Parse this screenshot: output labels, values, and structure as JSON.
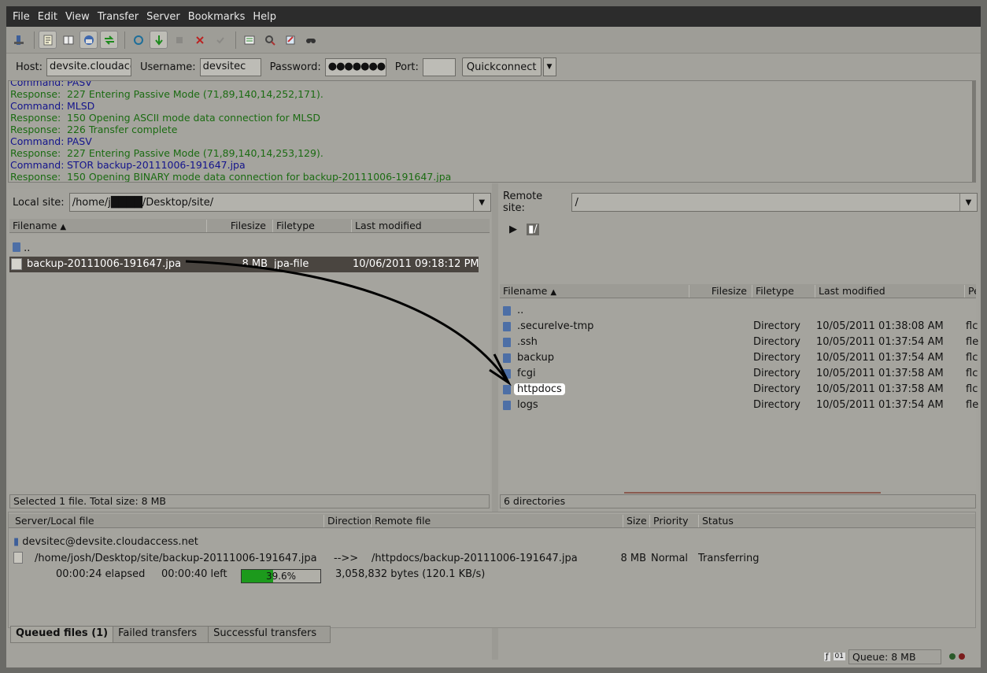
{
  "menu": [
    "File",
    "Edit",
    "View",
    "Transfer",
    "Server",
    "Bookmarks",
    "Help"
  ],
  "toolbar_icons": [
    "site-manager-icon",
    "toggle-log-icon",
    "toggle-local-tree-icon",
    "toggle-remote-tree-icon",
    "toggle-queue-icon",
    "refresh-icon",
    "process-queue-icon",
    "cancel-icon",
    "disconnect-icon",
    "reconnect-icon",
    "directory-listing-filters-icon",
    "sync-browse-icon",
    "compare-icon",
    "search-icon"
  ],
  "quickconnect": {
    "host_label": "Host:",
    "host": "devsite.cloudacc",
    "user_label": "Username:",
    "user": "devsitec",
    "pass_label": "Password:",
    "pass": "●●●●●●●",
    "port_label": "Port:",
    "port": "",
    "button": "Quickconnect"
  },
  "log": [
    {
      "k": "Command:",
      "t": "PASV",
      "type": "cmd"
    },
    {
      "k": "Response:",
      "t": "227 Entering Passive Mode (71,89,140,14,252,171).",
      "type": "resp"
    },
    {
      "k": "Command:",
      "t": "MLSD",
      "type": "cmd"
    },
    {
      "k": "Response:",
      "t": "150 Opening ASCII mode data connection for MLSD",
      "type": "resp"
    },
    {
      "k": "Response:",
      "t": "226 Transfer complete",
      "type": "resp"
    },
    {
      "k": "Command:",
      "t": "PASV",
      "type": "cmd"
    },
    {
      "k": "Response:",
      "t": "227 Entering Passive Mode (71,89,140,14,253,129).",
      "type": "resp"
    },
    {
      "k": "Command:",
      "t": "STOR backup-20111006-191647.jpa",
      "type": "cmd"
    },
    {
      "k": "Response:",
      "t": "150 Opening BINARY mode data connection for backup-20111006-191647.jpa",
      "type": "resp"
    }
  ],
  "local": {
    "label": "Local site:",
    "path": "/home/j████/Desktop/site/",
    "headers": [
      "Filename",
      "Filesize",
      "Filetype",
      "Last modified"
    ],
    "files": [
      {
        "name": "..",
        "size": "",
        "type": "",
        "modified": ""
      },
      {
        "name": "backup-20111006-191647.jpa",
        "size": "8 MB",
        "type": "jpa-file",
        "modified": "10/06/2011 09:18:12 PM"
      }
    ],
    "status": "Selected 1 file. Total size: 8 MB"
  },
  "remote": {
    "label": "Remote site:",
    "path": "/",
    "tree_root": "/",
    "headers": [
      "Filename",
      "Filesize",
      "Filetype",
      "Last modified",
      "Pe"
    ],
    "files": [
      {
        "name": "..",
        "type": "",
        "modified": "",
        "perm": ""
      },
      {
        "name": ".securelve-tmp",
        "type": "Directory",
        "modified": "10/05/2011 01:38:08 AM",
        "perm": "flc"
      },
      {
        "name": ".ssh",
        "type": "Directory",
        "modified": "10/05/2011 01:37:54 AM",
        "perm": "fle"
      },
      {
        "name": "backup",
        "type": "Directory",
        "modified": "10/05/2011 01:37:54 AM",
        "perm": "flc"
      },
      {
        "name": "fcgi",
        "type": "Directory",
        "modified": "10/05/2011 01:37:58 AM",
        "perm": "flc"
      },
      {
        "name": "httpdocs",
        "type": "Directory",
        "modified": "10/05/2011 01:37:58 AM",
        "perm": "flc"
      },
      {
        "name": "logs",
        "type": "Directory",
        "modified": "10/05/2011 01:37:54 AM",
        "perm": "fle"
      }
    ],
    "status": "6 directories"
  },
  "queue": {
    "headers": [
      "Server/Local file",
      "Direction",
      "Remote file",
      "Size",
      "Priority",
      "Status"
    ],
    "server": "devsitec@devsite.cloudaccess.net",
    "local_file": "/home/josh/Desktop/site/backup-20111006-191647.jpa",
    "direction": "-->>",
    "remote_file": "/httpdocs/backup-20111006-191647.jpa",
    "size": "8 MB",
    "priority": "Normal",
    "status": "Transferring",
    "elapsed": "00:00:24 elapsed",
    "left": "00:00:40 left",
    "progress_text": "39.6%",
    "progress": 0.396,
    "bytes": "3,058,832 bytes (120.1 KB/s)"
  },
  "tabs": [
    "Queued files (1)",
    "Failed transfers",
    "Successful transfers"
  ],
  "queue_status": "Queue: 8 MB"
}
